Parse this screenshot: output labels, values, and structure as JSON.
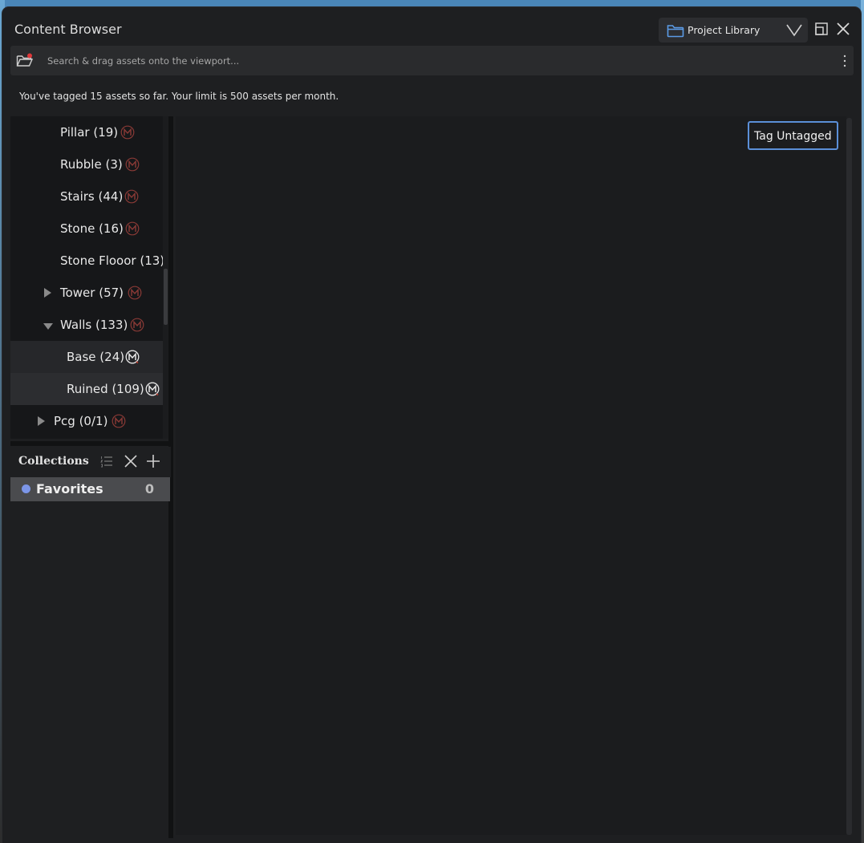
{
  "window": {
    "title": "Content Browser",
    "library_select": {
      "value": "Project Library"
    }
  },
  "search": {
    "placeholder": "Search & drag assets onto the viewport..."
  },
  "notice": "You've tagged 15 assets so far. Your limit is 500 assets per month.",
  "tree": {
    "items": [
      {
        "label": "Pillar (19)",
        "badge": true,
        "expander": "none"
      },
      {
        "label": "Rubble (3)",
        "badge": true,
        "expander": "none"
      },
      {
        "label": "Stairs (44)",
        "badge": true,
        "expander": "none"
      },
      {
        "label": "Stone (16)",
        "badge": true,
        "expander": "none"
      },
      {
        "label": "Stone Flooor (13)",
        "badge": false,
        "expander": "none"
      },
      {
        "label": "Tower (57)",
        "badge": true,
        "expander": "collapsed"
      },
      {
        "label": "Walls (133)",
        "badge": true,
        "expander": "expanded"
      },
      {
        "label": "Base (24)",
        "badge": true,
        "expander": "none",
        "state": "selected"
      },
      {
        "label": "Ruined (109)",
        "badge": true,
        "expander": "none",
        "state": "hover"
      },
      {
        "label": "Pcg (0/1)",
        "badge": true,
        "expander": "collapsed"
      }
    ]
  },
  "collections": {
    "title": "Collections",
    "items": [
      {
        "label": "Favorites",
        "count": "0",
        "color": "#7c96e8"
      }
    ]
  },
  "main": {
    "tag_untagged_label": "Tag Untagged"
  },
  "colors": {
    "accent": "#5b8fd8",
    "badge": "#c0392b",
    "window_bg": "#1e1f21"
  },
  "icons": [
    "folder-icon",
    "chevron-down-icon",
    "restore-icon",
    "close-icon",
    "folder-open-icon",
    "kebab-menu-icon",
    "megascans-badge-icon",
    "expand-arrow-icon",
    "sort-list-icon",
    "clear-icon",
    "add-icon"
  ]
}
